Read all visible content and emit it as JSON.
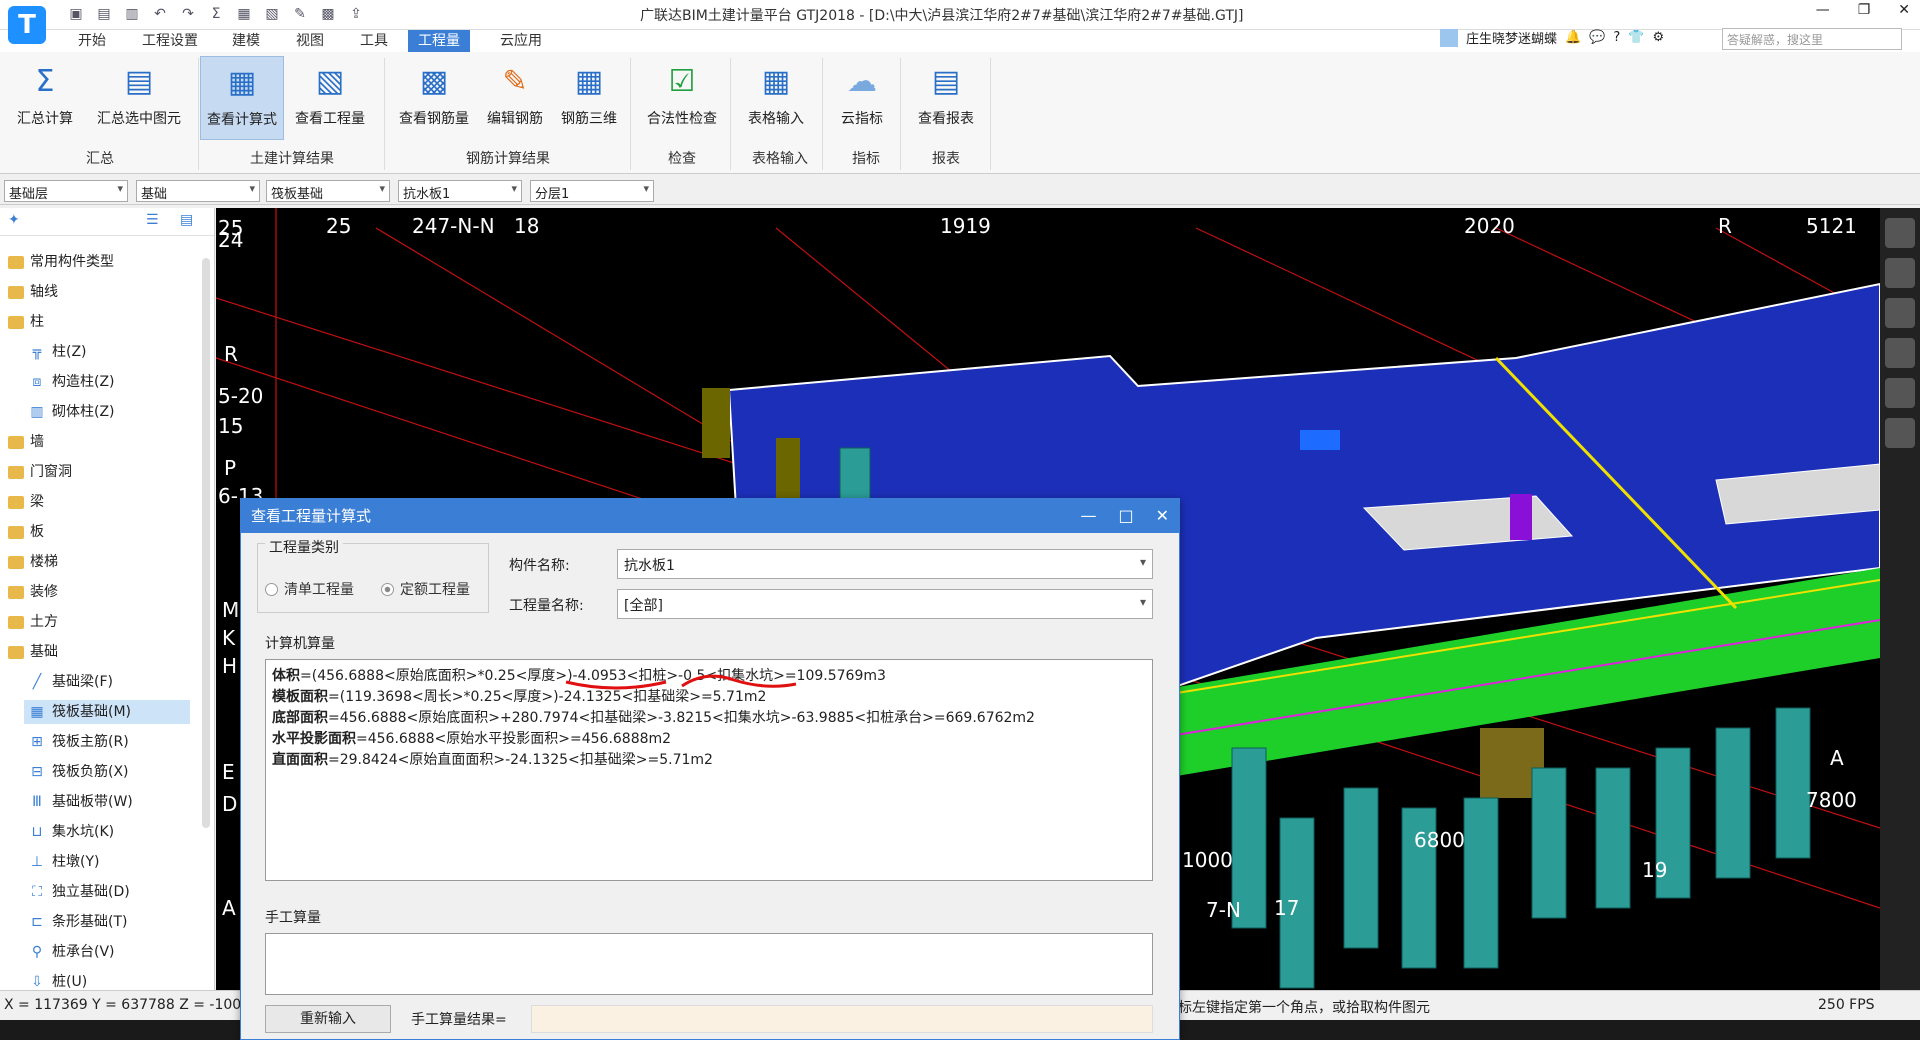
{
  "titlebar": {
    "app_logo": "T",
    "title": "广联达BIM土建计量平台 GTJ2018 - [D:\\中大\\泸县滨江华府2#7#基础\\滨江华府2#7#基础.GTJ]",
    "user_name": "庄生晓梦迷蝴蝶",
    "search_placeholder": "答疑解惑，搜这里",
    "help_label": "?"
  },
  "menu": {
    "tabs": [
      "开始",
      "工程设置",
      "建模",
      "视图",
      "工具",
      "工程量",
      "云应用"
    ],
    "active": "工程量"
  },
  "ribbon": {
    "buttons": [
      "汇总计算",
      "汇总选中图元",
      "查看计算式",
      "查看工程量",
      "查看钢筋量",
      "编辑钢筋",
      "钢筋三维",
      "合法性检查",
      "表格输入",
      "云指标",
      "查看报表"
    ],
    "groups": [
      "汇总",
      "土建计算结果",
      "钢筋计算结果",
      "检查",
      "表格输入",
      "指标",
      "报表"
    ]
  },
  "layerbar": {
    "floor": "基础层",
    "category": "基础",
    "type": "筏板基础",
    "element": "抗水板1",
    "layer": "分层1"
  },
  "tree": {
    "items": [
      "常用构件类型",
      "轴线",
      "柱",
      "柱(Z)",
      "构造柱(Z)",
      "砌体柱(Z)",
      "墙",
      "门窗洞",
      "梁",
      "板",
      "楼梯",
      "装修",
      "土方",
      "基础",
      "基础梁(F)",
      "筏板基础(M)",
      "筏板主筋(R)",
      "筏板负筋(X)",
      "基础板带(W)",
      "集水坑(K)",
      "柱墩(Y)",
      "独立基础(D)",
      "条形基础(T)",
      "桩承台(V)",
      "桩(U)"
    ]
  },
  "viewport": {
    "axis_labels": [
      "25",
      "24",
      "247-N-N",
      "18",
      "1919",
      "2020",
      "R",
      "5121",
      "R",
      "5-20",
      "15",
      "P",
      "6-13",
      "M",
      "K",
      "H",
      "E",
      "D",
      "A",
      "7800",
      "6800",
      "19",
      "1000",
      "7-N",
      "17",
      "A"
    ]
  },
  "status": {
    "coords": "X = 117369 Y = 637788 Z = -100",
    "hint": "标左键指定第一个角点，或拾取构件图元",
    "fps": "250 FPS"
  },
  "dialog": {
    "title": "查看工程量计算式",
    "qty_type_legend": "工程量类别",
    "radio_list": "清单工程量",
    "radio_quota": "定额工程量",
    "element_name_label": "构件名称:",
    "element_name_value": "抗水板1",
    "qty_name_label": "工程量名称:",
    "qty_name_value": "[全部]",
    "calc_section": "计算机算量",
    "calc_lines": [
      {
        "name": "体积",
        "formula": "=(456.6888<原始底面积>*0.25<厚度>)-4.0953<扣桩>-0.5<扣集水坑>=109.5769m3"
      },
      {
        "name": "模板面积",
        "formula": "=(119.3698<周长>*0.25<厚度>)-24.1325<扣基础梁>=5.71m2"
      },
      {
        "name": "底部面积",
        "formula": "=456.6888<原始底面积>+280.7974<扣基础梁>-3.8215<扣集水坑>-63.9885<扣桩承台>=669.6762m2"
      },
      {
        "name": "水平投影面积",
        "formula": "=456.6888<原始水平投影面积>=456.6888m2"
      },
      {
        "name": "直面面积",
        "formula": "=29.8424<原始直面面积>-24.1325<扣基础梁>=5.71m2"
      }
    ],
    "manual_section": "手工算量",
    "reinput_button": "重新输入",
    "manual_result_label": "手工算量结果="
  },
  "colors": {
    "accent": "#3a7fd5",
    "slab": "#1c2fb8",
    "beam": "#1ecf2a",
    "pile": "#2b9c96",
    "annotation_red": "#e01010"
  }
}
